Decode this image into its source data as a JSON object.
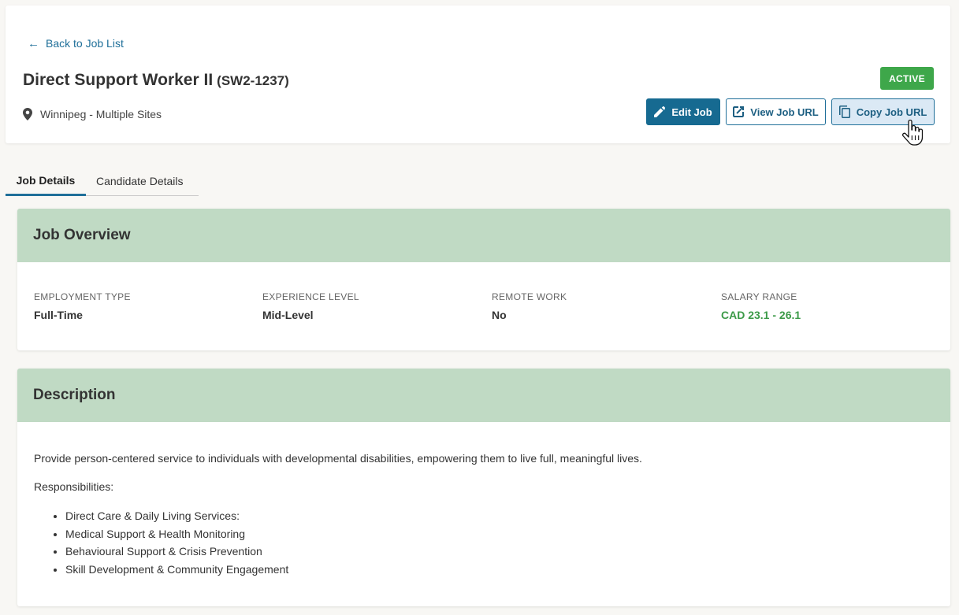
{
  "header": {
    "back_label": "Back to Job List",
    "back_arrow": "←",
    "title": "Direct Support Worker II",
    "job_code": "(SW2-1237)",
    "location": "Winnipeg - Multiple Sites",
    "status": "ACTIVE",
    "buttons": {
      "edit": "Edit Job",
      "view": "View Job URL",
      "copy": "Copy Job URL"
    }
  },
  "tabs": [
    {
      "label": "Job Details",
      "active": true
    },
    {
      "label": "Candidate Details",
      "active": false
    }
  ],
  "overview": {
    "title": "Job Overview",
    "fields": [
      {
        "label": "EMPLOYMENT TYPE",
        "value": "Full-Time"
      },
      {
        "label": "EXPERIENCE LEVEL",
        "value": "Mid-Level"
      },
      {
        "label": "REMOTE WORK",
        "value": "No"
      },
      {
        "label": "SALARY RANGE",
        "value": "CAD 23.1 - 26.1"
      }
    ]
  },
  "description": {
    "title": "Description",
    "intro": "Provide person-centered service to individuals with developmental disabilities, empowering them to live full, meaningful lives.",
    "responsibilities_label": "Responsibilities:",
    "responsibilities": [
      "Direct Care & Daily Living Services:",
      "Medical Support & Health Monitoring",
      "Behavioural Support & Crisis Prevention",
      "Skill Development & Community Engagement"
    ]
  },
  "colors": {
    "primary": "#166a91",
    "active_badge": "#3ea74a",
    "section_header": "#c0dac4",
    "salary": "#3c9a48"
  },
  "icons": {
    "back": "arrow-left-icon",
    "location": "map-pin-icon",
    "edit": "pencil-icon",
    "view": "external-link-icon",
    "copy": "copy-icon"
  }
}
